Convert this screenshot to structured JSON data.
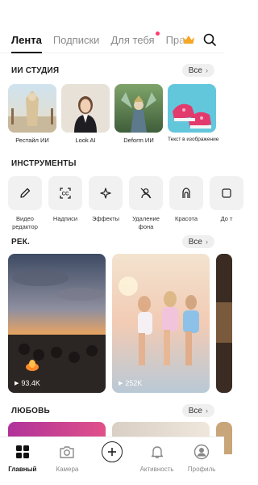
{
  "tabs": [
    {
      "label": "Лента",
      "active": true
    },
    {
      "label": "Подписки"
    },
    {
      "label": "Для тебя",
      "dot": true
    },
    {
      "label": "Праймі"
    }
  ],
  "ai_studio": {
    "title": "ИИ СТУДИЯ",
    "all_label": "Все",
    "items": [
      {
        "label": "Рестайл ИИ"
      },
      {
        "label": "Look AI"
      },
      {
        "label": "Deform ИИ"
      },
      {
        "label": "Текст в изображение"
      }
    ]
  },
  "tools": {
    "title": "ИНСТРУМЕНТЫ",
    "items": [
      {
        "label": "Видео редактор",
        "icon": "pencil-icon"
      },
      {
        "label": "Надписи",
        "icon": "captions-icon"
      },
      {
        "label": "Эффекты",
        "icon": "sparkle-icon"
      },
      {
        "label": "Удаление фона",
        "icon": "remove-bg-icon"
      },
      {
        "label": "Красота",
        "icon": "beauty-icon"
      },
      {
        "label": "До т",
        "icon": "partial-icon"
      }
    ]
  },
  "rec": {
    "title": "РЕК.",
    "all_label": "Все",
    "items": [
      {
        "views": "93.4K"
      },
      {
        "views": "252K"
      }
    ]
  },
  "love": {
    "title": "ЛЮБОВЬ",
    "all_label": "Все"
  },
  "bottom_nav": [
    {
      "label": "Главный",
      "icon": "home-grid-icon",
      "active": true
    },
    {
      "label": "Камера",
      "icon": "camera-icon"
    },
    {
      "label": "",
      "icon": "plus-icon"
    },
    {
      "label": "Активность",
      "icon": "bell-icon"
    },
    {
      "label": "Профиль",
      "icon": "profile-icon"
    }
  ]
}
